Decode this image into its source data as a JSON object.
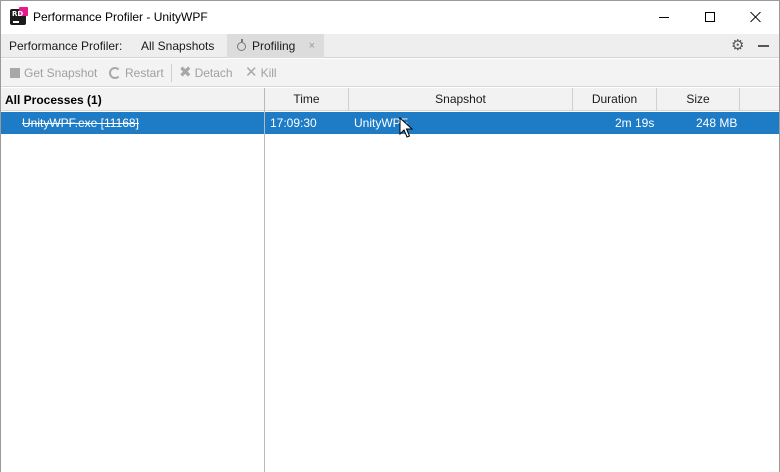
{
  "window": {
    "title": "Performance Profiler - UnityWPF",
    "app_icon": "rider-icon"
  },
  "tabs": {
    "prefix": "Performance Profiler:",
    "items": [
      {
        "label": "All Snapshots",
        "active": false
      },
      {
        "label": "Profiling",
        "active": true,
        "icon": "stopwatch-icon"
      }
    ],
    "tab_close_glyph": "×"
  },
  "toolbar": {
    "get_snapshot": "Get Snapshot",
    "restart": "Restart",
    "detach": "Detach",
    "kill": "Kill"
  },
  "processes": {
    "header": "All Processes (1)",
    "items": [
      {
        "label": "UnityWPF.exe [11168]",
        "selected": true,
        "struck": true
      }
    ]
  },
  "snapshots": {
    "columns": [
      "Time",
      "Snapshot",
      "Duration",
      "Size"
    ],
    "rows": [
      {
        "time": "17:09:30",
        "snapshot": "UnityWPF",
        "duration": "2m 19s",
        "size": "248 MB",
        "selected": true
      }
    ]
  },
  "colors": {
    "selection": "#1e7bc6",
    "header_bg": "#f2f2f2",
    "disabled_text": "#a0a0a0"
  }
}
